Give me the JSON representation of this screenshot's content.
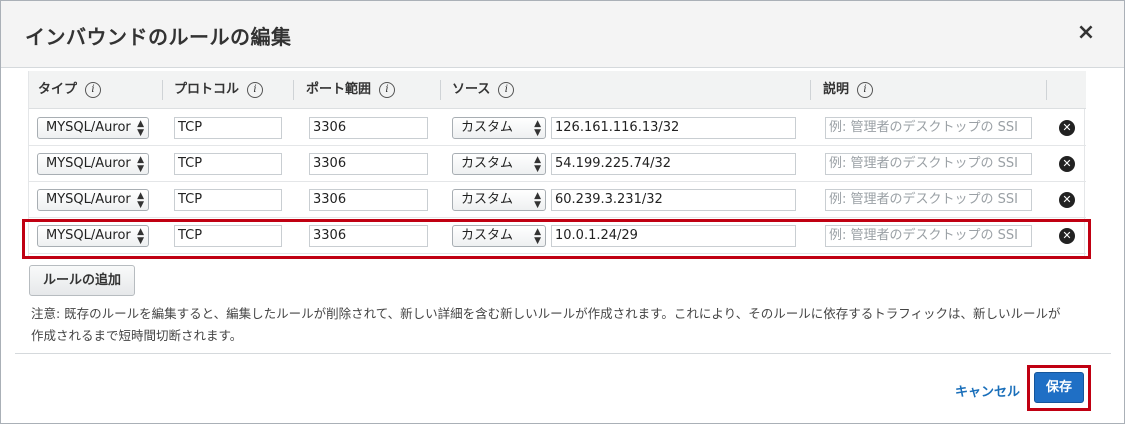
{
  "dialog": {
    "title": "インバウンドのルールの編集",
    "close_glyph": "×"
  },
  "table": {
    "headers": [
      {
        "label": "タイプ"
      },
      {
        "label": "プロトコル"
      },
      {
        "label": "ポート範囲"
      },
      {
        "label": "ソース"
      },
      {
        "label": "説明"
      }
    ],
    "info_glyph": "i",
    "rows": [
      {
        "type": "MYSQL/Auror",
        "protocol": "TCP",
        "port": "3306",
        "source_type": "カスタム",
        "source_value": "126.161.116.13/32",
        "description_placeholder": "例: 管理者のデスクトップの SSI"
      },
      {
        "type": "MYSQL/Auror",
        "protocol": "TCP",
        "port": "3306",
        "source_type": "カスタム",
        "source_value": "54.199.225.74/32",
        "description_placeholder": "例: 管理者のデスクトップの SSI"
      },
      {
        "type": "MYSQL/Auror",
        "protocol": "TCP",
        "port": "3306",
        "source_type": "カスタム",
        "source_value": "60.239.3.231/32",
        "description_placeholder": "例: 管理者のデスクトップの SSI"
      },
      {
        "type": "MYSQL/Auror",
        "protocol": "TCP",
        "port": "3306",
        "source_type": "カスタム",
        "source_value": "10.0.1.24/29",
        "description_placeholder": "例: 管理者のデスクトップの SSI"
      }
    ],
    "delete_glyph": "✕",
    "select_arrows": "▲▼"
  },
  "add_rule_label": "ルールの追加",
  "note_text": "注意: 既存のルールを編集すると、編集したルールが削除されて、新しい詳細を含む新しいルールが作成されます。これにより、そのルールに依存するトラフィックは、新しいルールが作成されるまで短時間切断されます。",
  "footer": {
    "cancel_label": "キャンセル",
    "save_label": "保存"
  },
  "colors": {
    "highlight": "#c00012",
    "primary": "#1f6fc5",
    "link": "#1a6fba"
  }
}
